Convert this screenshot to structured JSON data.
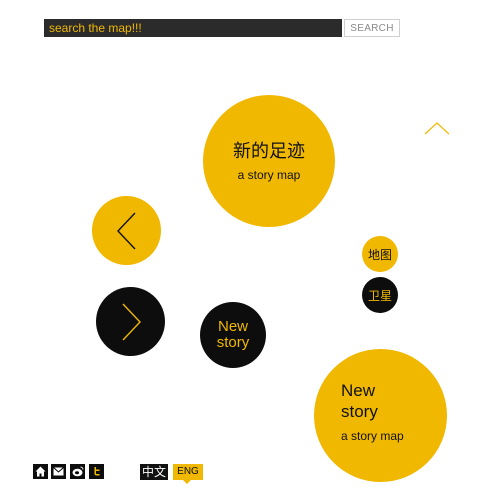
{
  "search": {
    "placeholder": "search the map!!!",
    "button_label": "SEARCH"
  },
  "title_circle": {
    "title_cn": "新的足迹",
    "subtitle": "a story map"
  },
  "nav": {
    "prev_icon": "chevron-left-icon",
    "next_icon": "chevron-right-icon",
    "up_icon": "chevron-up-icon"
  },
  "new_story_small": {
    "line1": "New",
    "line2": "story"
  },
  "map_toggle": {
    "map_label": "地图",
    "satellite_label": "卫星"
  },
  "new_story_large": {
    "line1": "New",
    "line2": "story",
    "subtitle": "a story map"
  },
  "footer": {
    "icons": [
      "home-icon",
      "mail-icon",
      "weibo-icon",
      "twitter-icon"
    ],
    "lang_cn": "中文",
    "lang_en": "ENG"
  },
  "colors": {
    "accent": "#f0b800",
    "dark": "#0d0d0d",
    "background": "#ffffff"
  }
}
